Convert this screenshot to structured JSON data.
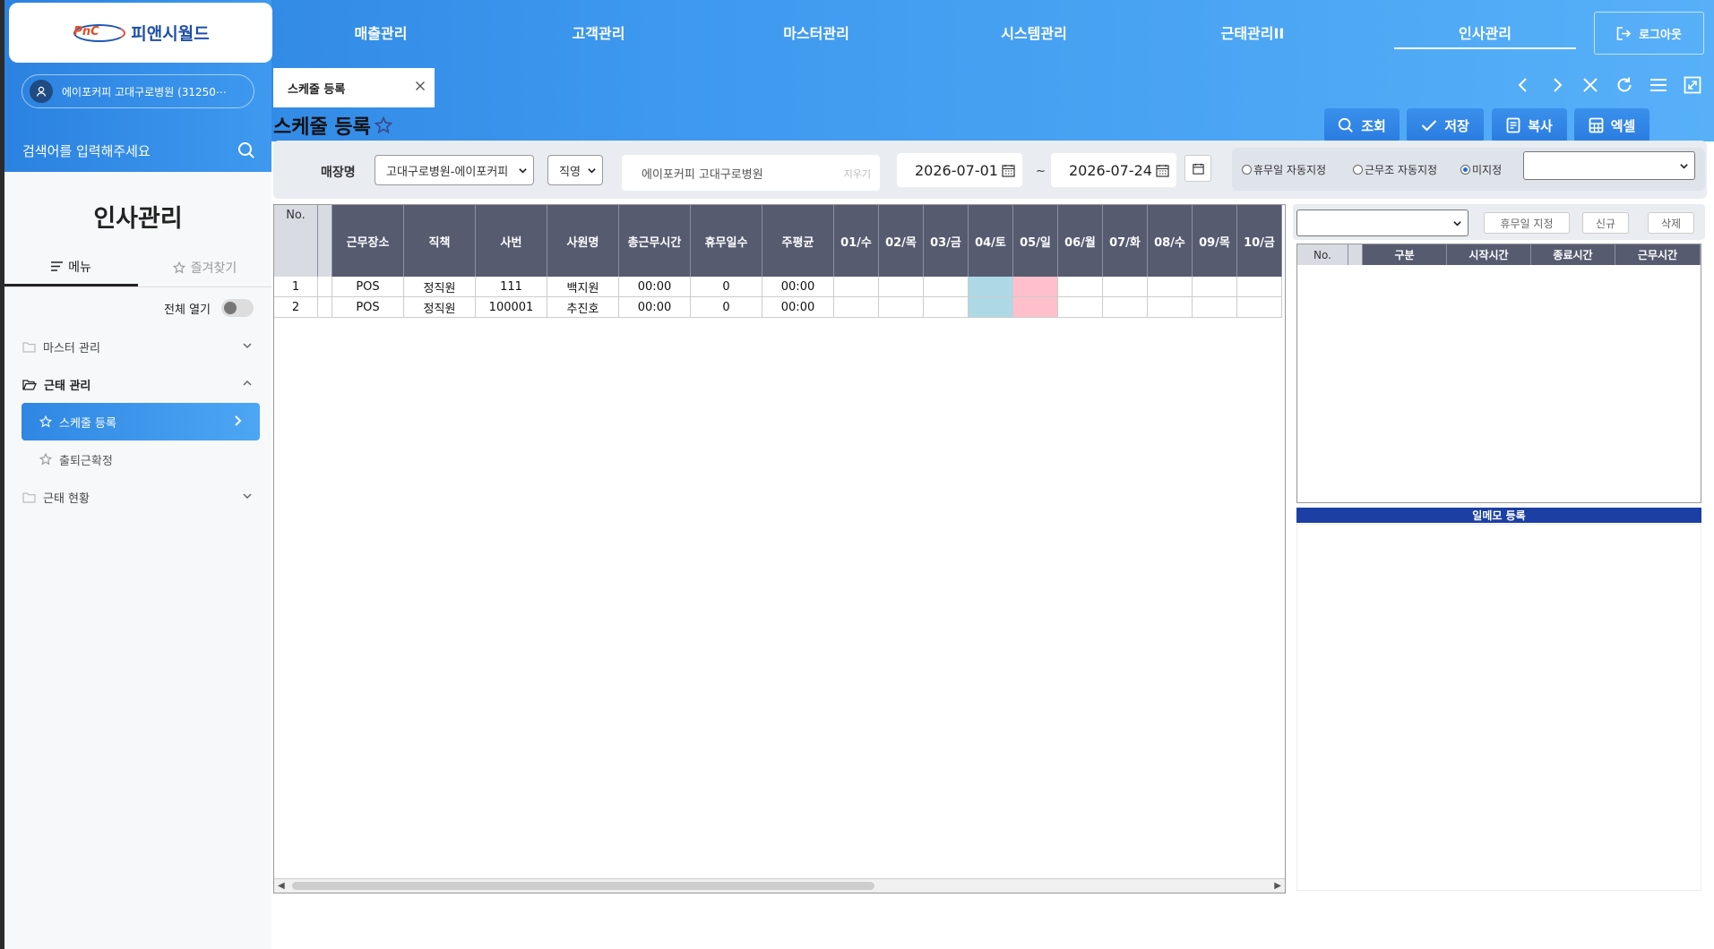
{
  "brand": {
    "logo_mark": "PnC",
    "name": "피앤시월드"
  },
  "user": {
    "store": "에이포커피 고대구로병원 (31250⋯"
  },
  "search": {
    "placeholder": "검색어를 입력해주세요"
  },
  "sidebar": {
    "title": "인사관리",
    "tabs": [
      {
        "label": "메뉴"
      },
      {
        "label": "즐겨찾기"
      }
    ],
    "expand_all": "전체 열기",
    "items": [
      {
        "label": "마스터 관리"
      },
      {
        "label": "근태 관리",
        "children": [
          {
            "label": "스케줄 등록"
          },
          {
            "label": "출퇴근확정"
          }
        ]
      },
      {
        "label": "근태 현황"
      }
    ]
  },
  "nav": {
    "items": [
      {
        "label": "매출관리"
      },
      {
        "label": "고객관리"
      },
      {
        "label": "마스터관리"
      },
      {
        "label": "시스템관리"
      },
      {
        "label": "근태관리II"
      },
      {
        "label": "인사관리"
      }
    ],
    "logout": "로그아웃"
  },
  "tab": {
    "label": "스케줄 등록"
  },
  "page": {
    "title": "스케줄 등록"
  },
  "actions": {
    "search": "조회",
    "save": "저장",
    "copy": "복사",
    "excel": "엑셀"
  },
  "filters": {
    "store_label": "매장명",
    "store_select": "고대구로병원-에이포커피",
    "type_select": "직영",
    "store_name": "에이포커피 고대구로병원",
    "store_clear": "지우기",
    "date_from": "2026-07-01",
    "date_sep": "~",
    "date_to": "2026-07-24",
    "radios": [
      {
        "label": "휴무일 자동지정",
        "checked": false
      },
      {
        "label": "근무조 자동지정",
        "checked": false
      },
      {
        "label": "미지정",
        "checked": true
      }
    ]
  },
  "grid": {
    "columns": [
      "No.",
      "",
      "근무장소",
      "직책",
      "사번",
      "사원명",
      "총근무시간",
      "휴무일수",
      "주평균",
      "01/수",
      "02/목",
      "03/금",
      "04/토",
      "05/일",
      "06/월",
      "07/화",
      "08/수",
      "09/목",
      "10/금"
    ],
    "rows": [
      {
        "no": "1",
        "place": "POS",
        "position": "정직원",
        "emp_no": "111",
        "name": "백지원",
        "total": "00:00",
        "off_days": "0",
        "weekly_avg": "00:00"
      },
      {
        "no": "2",
        "place": "POS",
        "position": "정직원",
        "emp_no": "100001",
        "name": "추진호",
        "total": "00:00",
        "off_days": "0",
        "weekly_avg": "00:00"
      }
    ],
    "colors": {
      "saturday": "#add8e6",
      "sunday": "#ffc0cb"
    }
  },
  "right": {
    "buttons": {
      "holiday": "휴무일 지정",
      "new": "신규",
      "delete": "삭제"
    },
    "columns": [
      "No.",
      "",
      "구분",
      "시작시간",
      "종료시간",
      "근무시간"
    ],
    "memo_title": "일메모 등록"
  },
  "colors": {
    "accent": "#2b82e0",
    "header": "#565b70",
    "memo": "#1b3fa3"
  }
}
